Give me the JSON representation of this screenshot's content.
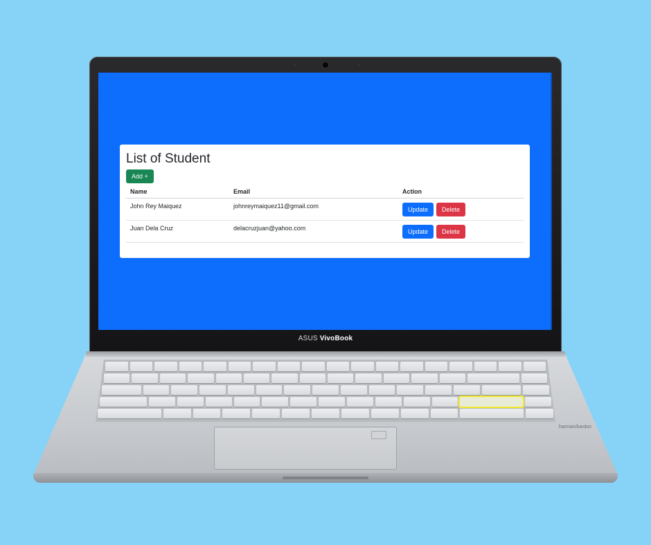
{
  "device": {
    "brand_prefix": "ASUS ",
    "brand_name": "VivoBook",
    "speaker_brand": "harman/kardon"
  },
  "page": {
    "title": "List of Student",
    "add_button": "Add +",
    "table": {
      "headers": [
        "Name",
        "Email",
        "Action"
      ],
      "rows": [
        {
          "name": "John Rey Maiquez",
          "email": "johnreymaiquez11@gmail.com"
        },
        {
          "name": "Juan Dela Cruz",
          "email": "delacruzjuan@yahoo.com"
        }
      ],
      "update_label": "Update",
      "delete_label": "Delete"
    }
  },
  "colors": {
    "background": "#87d3f8",
    "screen": "#0d6efd",
    "add": "#198754",
    "update": "#0d6efd",
    "delete": "#dc3545"
  }
}
